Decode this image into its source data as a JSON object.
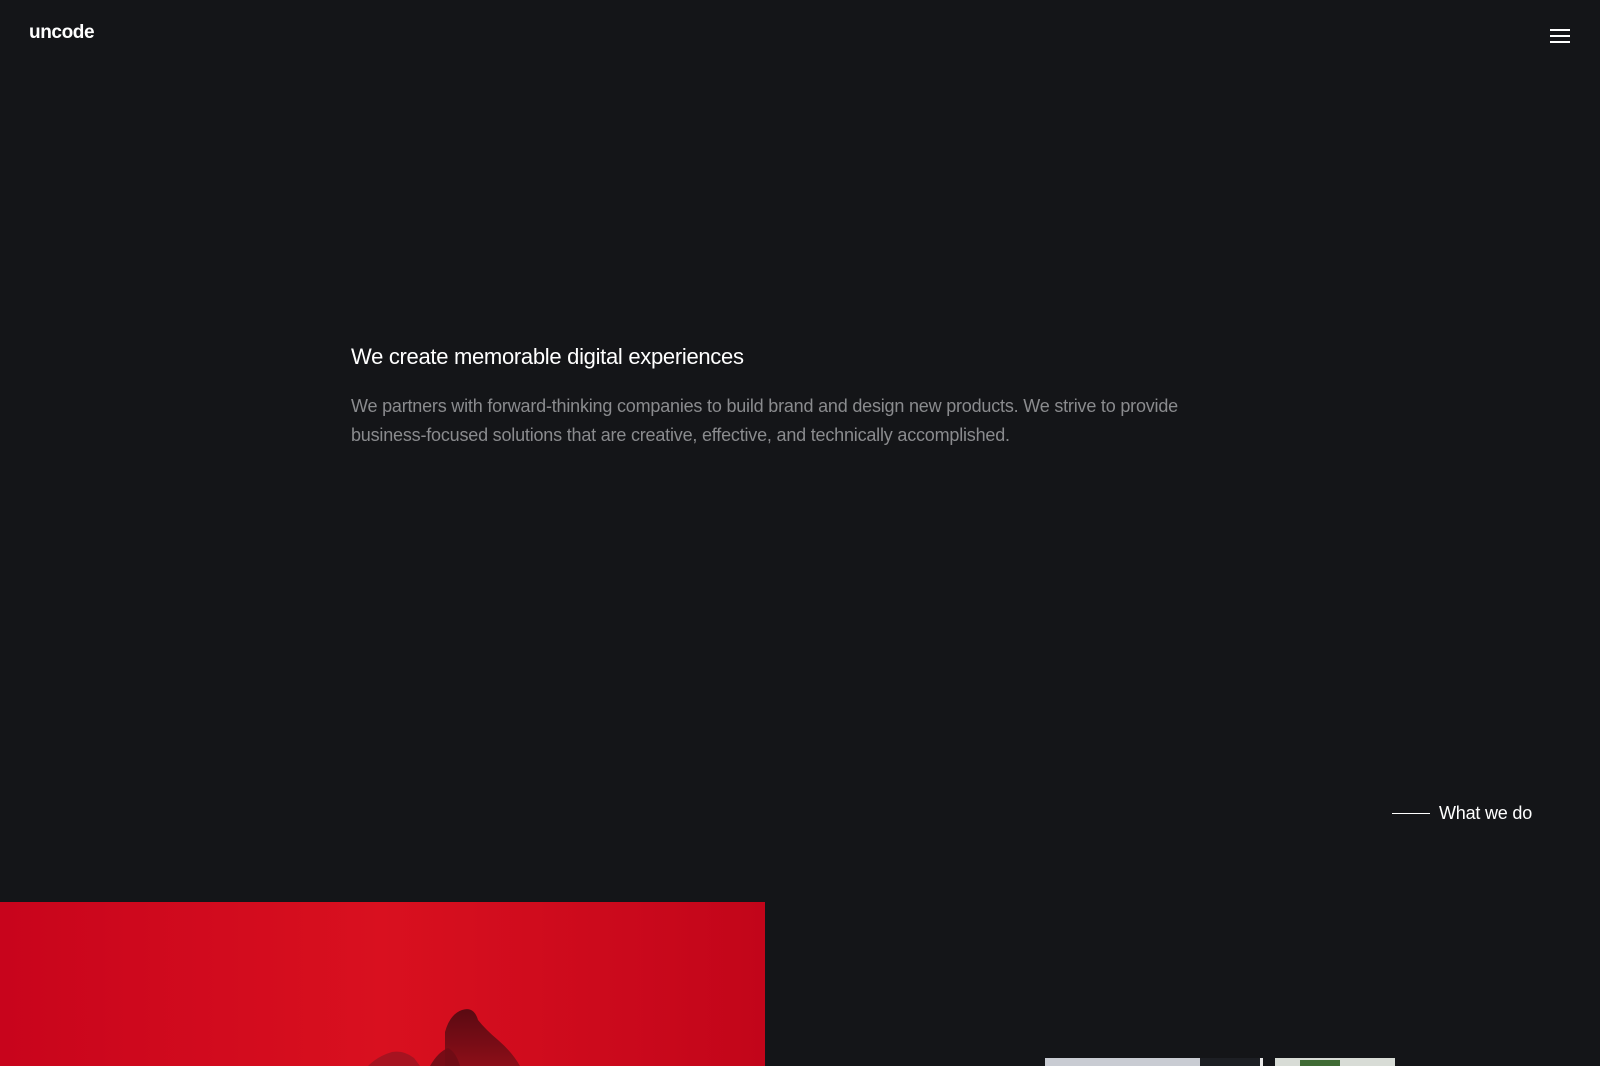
{
  "header": {
    "logo_text": "uncode",
    "menu_icon": "hamburger-menu-icon"
  },
  "hero": {
    "title": "We create memorable digital experiences",
    "description": "We partners with forward-thinking companies to build brand and design new products. We strive to provide business-focused solutions that are creative, effective, and technically accomplished."
  },
  "section_link": {
    "label": "What we do"
  },
  "colors": {
    "background": "#141518",
    "text_primary": "#ffffff",
    "text_secondary": "#8a8b8e",
    "accent_red": "#d0051f"
  }
}
